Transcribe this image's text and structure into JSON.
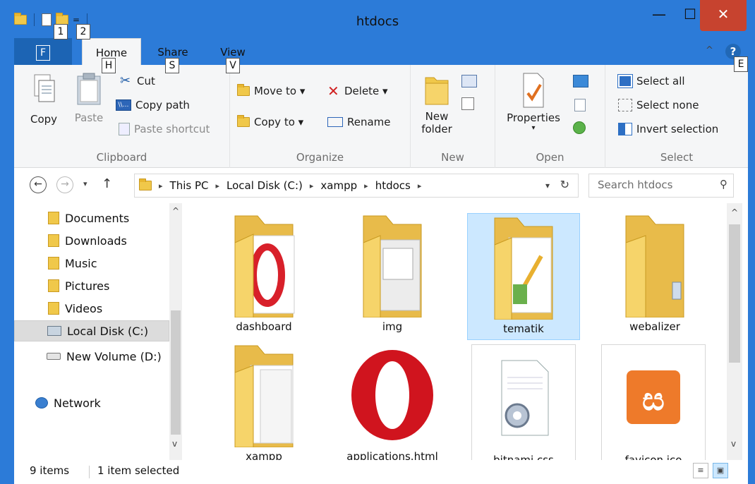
{
  "window": {
    "title": "htdocs",
    "min_label": "—",
    "max_label": "☐",
    "close_label": "✕"
  },
  "quick_access": {
    "keytips": [
      "1",
      "2"
    ],
    "dropdown_label": "="
  },
  "tabs": {
    "file": {
      "label": "F"
    },
    "home": {
      "label": "Home",
      "keytip": "H"
    },
    "share": {
      "label": "Share",
      "keytip": "S"
    },
    "view": {
      "label": "View",
      "keytip": "V"
    },
    "help_keytip": "E"
  },
  "ribbon": {
    "clipboard": {
      "label": "Clipboard",
      "copy": "Copy",
      "paste": "Paste",
      "cut": "Cut",
      "copy_path": "Copy path",
      "paste_shortcut": "Paste shortcut"
    },
    "organize": {
      "label": "Organize",
      "move_to": "Move to ▾",
      "copy_to": "Copy to ▾",
      "delete": "Delete ▾",
      "rename": "Rename"
    },
    "new": {
      "label": "New",
      "new_folder_1": "New",
      "new_folder_2": "folder"
    },
    "open": {
      "label": "Open",
      "properties": "Properties"
    },
    "select": {
      "label": "Select",
      "select_all": "Select all",
      "select_none": "Select none",
      "invert_selection": "Invert selection"
    }
  },
  "address": {
    "crumbs": [
      "This PC",
      "Local Disk (C:)",
      "xampp",
      "htdocs"
    ],
    "search_placeholder": "Search htdocs"
  },
  "nav": {
    "items": [
      {
        "label": "Documents"
      },
      {
        "label": "Downloads"
      },
      {
        "label": "Music"
      },
      {
        "label": "Pictures"
      },
      {
        "label": "Videos"
      },
      {
        "label": "Local Disk (C:)"
      },
      {
        "label": "New Volume (D:)"
      },
      {
        "label": "Network"
      }
    ]
  },
  "files": {
    "items": [
      {
        "name": "dashboard"
      },
      {
        "name": "img"
      },
      {
        "name": "tematik"
      },
      {
        "name": "webalizer"
      },
      {
        "name": "xampp"
      },
      {
        "name": "applications.html"
      },
      {
        "name": "bitnami.css"
      },
      {
        "name": "favicon.ico"
      }
    ]
  },
  "status": {
    "count": "9 items",
    "selection": "1 item selected"
  },
  "colors": {
    "titlebar": "#2c7bd8",
    "selection": "#cce8ff",
    "close": "#c7432f",
    "folder": "#f0c84a"
  }
}
